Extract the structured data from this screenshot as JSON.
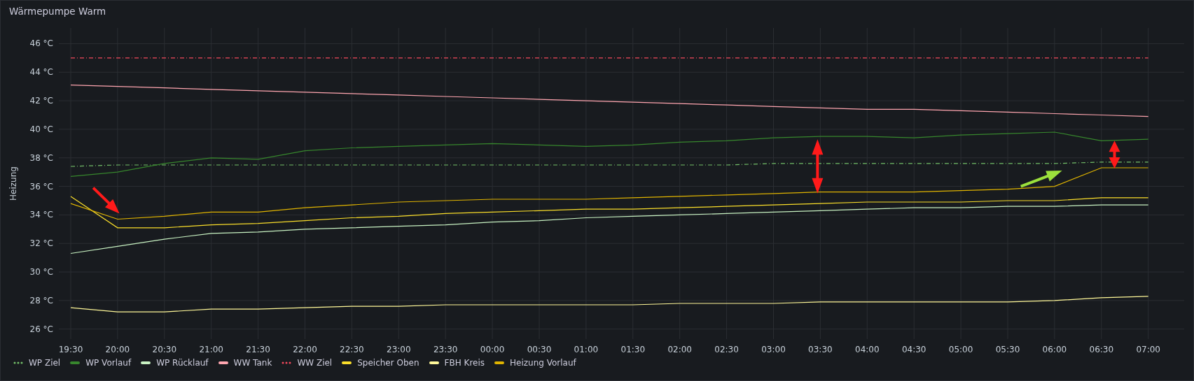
{
  "panel": {
    "title": "Wärmepumpe Warm"
  },
  "chart_data": {
    "type": "line",
    "ylabel": "Heizung",
    "grid": true,
    "categories": [
      "19:30",
      "20:00",
      "20:30",
      "21:00",
      "21:30",
      "22:00",
      "22:30",
      "23:00",
      "23:30",
      "00:00",
      "00:30",
      "01:00",
      "01:30",
      "02:00",
      "02:30",
      "03:00",
      "03:30",
      "04:00",
      "04:30",
      "05:00",
      "05:30",
      "06:00",
      "06:30",
      "07:00"
    ],
    "ylim": [
      25.3,
      47.1
    ],
    "yticks": [
      {
        "value": 26,
        "label": "26 °C"
      },
      {
        "value": 28,
        "label": "28 °C"
      },
      {
        "value": 30,
        "label": "30 °C"
      },
      {
        "value": 32,
        "label": "32 °C"
      },
      {
        "value": 34,
        "label": "34 °C"
      },
      {
        "value": 36,
        "label": "36 °C"
      },
      {
        "value": 38,
        "label": "38 °C"
      },
      {
        "value": 40,
        "label": "40 °C"
      },
      {
        "value": 42,
        "label": "42 °C"
      },
      {
        "value": 44,
        "label": "44 °C"
      },
      {
        "value": 46,
        "label": "46 °C"
      }
    ],
    "series": [
      {
        "name": "WP Ziel",
        "color": "#73bf69",
        "line_style": "dashed",
        "values": [
          37.4,
          37.5,
          37.5,
          37.5,
          37.5,
          37.5,
          37.5,
          37.5,
          37.5,
          37.5,
          37.5,
          37.5,
          37.5,
          37.5,
          37.5,
          37.6,
          37.6,
          37.6,
          37.6,
          37.6,
          37.6,
          37.6,
          37.7,
          37.7
        ]
      },
      {
        "name": "WP Vorlauf",
        "color": "#37872d",
        "line_style": "solid",
        "values": [
          36.7,
          37.0,
          37.6,
          38.0,
          37.9,
          38.5,
          38.7,
          38.8,
          38.9,
          39.0,
          38.9,
          38.8,
          38.9,
          39.1,
          39.2,
          39.4,
          39.5,
          39.5,
          39.4,
          39.6,
          39.7,
          39.8,
          39.2,
          39.3
        ]
      },
      {
        "name": "WP Rücklauf",
        "color": "#c8f2c2",
        "line_style": "solid",
        "values": [
          31.3,
          31.8,
          32.3,
          32.7,
          32.8,
          33.0,
          33.1,
          33.2,
          33.3,
          33.5,
          33.6,
          33.8,
          33.9,
          34.0,
          34.1,
          34.2,
          34.3,
          34.4,
          34.5,
          34.5,
          34.6,
          34.6,
          34.7,
          34.7
        ]
      },
      {
        "name": "WW Tank",
        "color": "#ffa6b0",
        "line_style": "solid",
        "values": [
          43.1,
          43.0,
          42.9,
          42.8,
          42.7,
          42.6,
          42.5,
          42.4,
          42.3,
          42.2,
          42.1,
          42.0,
          41.9,
          41.8,
          41.7,
          41.6,
          41.5,
          41.4,
          41.4,
          41.3,
          41.2,
          41.1,
          41.0,
          40.9
        ]
      },
      {
        "name": "WW Ziel",
        "color": "#f2495c",
        "line_style": "dashed",
        "values": [
          45,
          45,
          45,
          45,
          45,
          45,
          45,
          45,
          45,
          45,
          45,
          45,
          45,
          45,
          45,
          45,
          45,
          45,
          45,
          45,
          45,
          45,
          45,
          45
        ]
      },
      {
        "name": "Speicher Oben",
        "color": "#fade2a",
        "line_style": "solid",
        "values": [
          35.3,
          33.1,
          33.1,
          33.3,
          33.4,
          33.6,
          33.8,
          33.9,
          34.1,
          34.2,
          34.3,
          34.4,
          34.4,
          34.5,
          34.6,
          34.7,
          34.8,
          34.9,
          34.9,
          34.9,
          35.0,
          35.0,
          35.2,
          35.2
        ]
      },
      {
        "name": "FBH Kreis",
        "color": "#fff899",
        "line_style": "solid",
        "values": [
          27.5,
          27.2,
          27.2,
          27.4,
          27.4,
          27.5,
          27.6,
          27.6,
          27.7,
          27.7,
          27.7,
          27.7,
          27.7,
          27.8,
          27.8,
          27.8,
          27.9,
          27.9,
          27.9,
          27.9,
          27.9,
          28.0,
          28.2,
          28.3
        ]
      },
      {
        "name": "Heizung Vorlauf",
        "color": "#e0b400",
        "line_style": "solid",
        "values": [
          34.8,
          33.7,
          33.9,
          34.2,
          34.2,
          34.5,
          34.7,
          34.9,
          35.0,
          35.1,
          35.1,
          35.1,
          35.2,
          35.3,
          35.4,
          35.5,
          35.6,
          35.6,
          35.6,
          35.7,
          35.8,
          36.0,
          37.3,
          37.3
        ]
      }
    ]
  },
  "overlay_arrows": [
    {
      "kind": "arrow",
      "color": "#ff1a1a"
    },
    {
      "kind": "double-arrow",
      "color": "#ff1a1a"
    },
    {
      "kind": "arrow",
      "color": "#9be03c"
    },
    {
      "kind": "double-arrow",
      "color": "#ff1a1a"
    }
  ]
}
